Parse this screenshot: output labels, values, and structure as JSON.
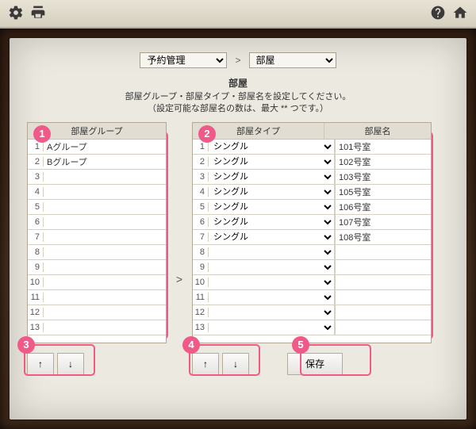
{
  "topbar": {
    "icons": {
      "settings": "settings",
      "print": "print",
      "help": "help",
      "home": "home"
    }
  },
  "crumbs": {
    "first": {
      "selected": "予約管理",
      "options": [
        "予約管理"
      ]
    },
    "sep": ">",
    "second": {
      "selected": "部屋",
      "options": [
        "部屋"
      ]
    }
  },
  "headings": {
    "title": "部屋",
    "sub1": "部屋グループ・部屋タイプ・部屋名を設定してください。",
    "sub2": "（設定可能な部屋名の数は、最大 ** つです。）"
  },
  "leftTable": {
    "header": "部屋グループ",
    "rows": [
      {
        "n": 1,
        "v": "Aグループ"
      },
      {
        "n": 2,
        "v": "Bグループ"
      },
      {
        "n": 3,
        "v": ""
      },
      {
        "n": 4,
        "v": ""
      },
      {
        "n": 5,
        "v": ""
      },
      {
        "n": 6,
        "v": ""
      },
      {
        "n": 7,
        "v": ""
      },
      {
        "n": 8,
        "v": ""
      },
      {
        "n": 9,
        "v": ""
      },
      {
        "n": 10,
        "v": ""
      },
      {
        "n": 11,
        "v": ""
      },
      {
        "n": 12,
        "v": ""
      },
      {
        "n": 13,
        "v": ""
      }
    ]
  },
  "separator": ">",
  "rightTable": {
    "header1": "部屋タイプ",
    "header2": "部屋名",
    "typeOption": "シングル",
    "rows": [
      {
        "n": 1,
        "type": "シングル",
        "name": "101号室"
      },
      {
        "n": 2,
        "type": "シングル",
        "name": "102号室"
      },
      {
        "n": 3,
        "type": "シングル",
        "name": "103号室"
      },
      {
        "n": 4,
        "type": "シングル",
        "name": "105号室"
      },
      {
        "n": 5,
        "type": "シングル",
        "name": "106号室"
      },
      {
        "n": 6,
        "type": "シングル",
        "name": "107号室"
      },
      {
        "n": 7,
        "type": "シングル",
        "name": "108号室"
      },
      {
        "n": 8,
        "type": "",
        "name": ""
      },
      {
        "n": 9,
        "type": "",
        "name": ""
      },
      {
        "n": 10,
        "type": "",
        "name": ""
      },
      {
        "n": 11,
        "type": "",
        "name": ""
      },
      {
        "n": 12,
        "type": "",
        "name": ""
      },
      {
        "n": 13,
        "type": "",
        "name": ""
      }
    ]
  },
  "buttons": {
    "up": "↑",
    "down": "↓",
    "save": "保存"
  },
  "annotations": {
    "b1": "1",
    "b2": "2",
    "b3": "3",
    "b4": "4",
    "b5": "5"
  }
}
